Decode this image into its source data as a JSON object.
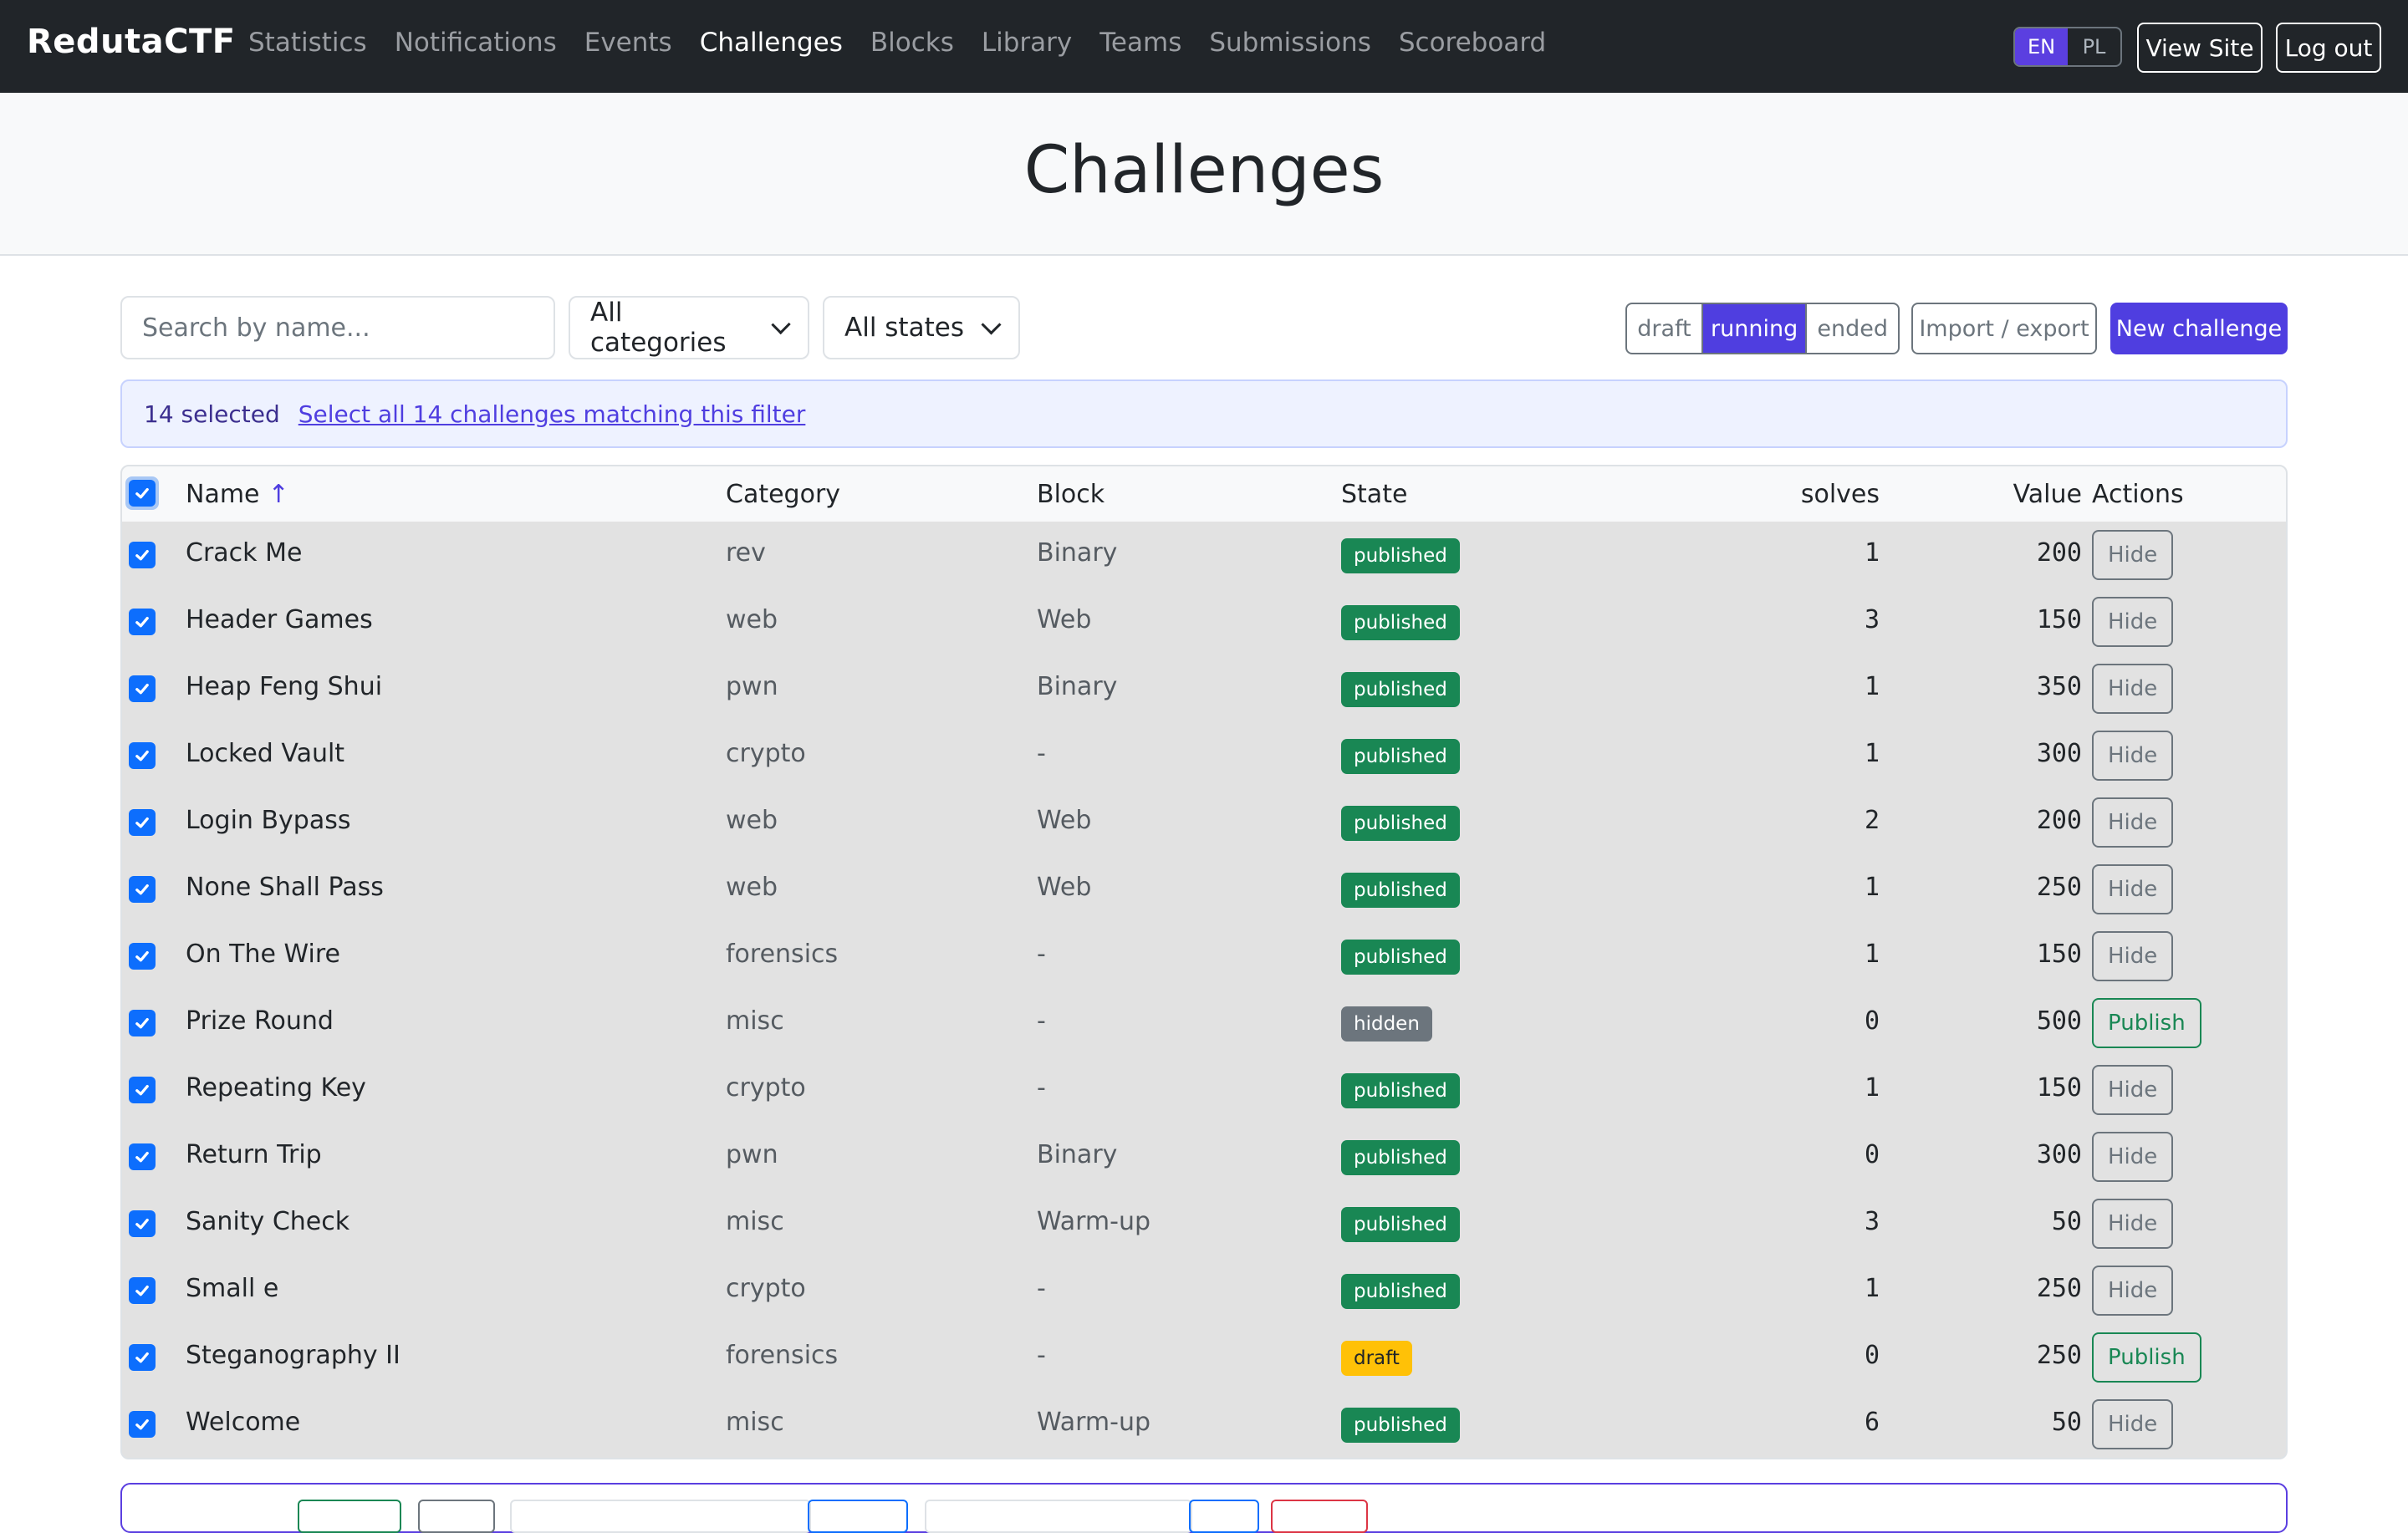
{
  "brand": "RedutaCTF",
  "nav": {
    "links": [
      "Statistics",
      "Notifications",
      "Events",
      "Challenges",
      "Blocks",
      "Library",
      "Teams",
      "Submissions",
      "Scoreboard"
    ],
    "active": "Challenges",
    "lang": [
      "EN",
      "PL"
    ],
    "lang_active": "EN",
    "view_site": "View Site",
    "logout": "Log out"
  },
  "page": {
    "title": "Challenges"
  },
  "toolbar": {
    "search_placeholder": "Search by name...",
    "category_select": "All categories",
    "state_select": "All states",
    "state_toggle": [
      "draft",
      "running",
      "ended"
    ],
    "state_toggle_active": "running",
    "import_export": "Import / export",
    "new_challenge": "New challenge"
  },
  "selection": {
    "count_text": "14 selected",
    "select_all_text": "Select all 14 challenges matching this filter"
  },
  "table": {
    "headers": {
      "name": "Name",
      "sort_indicator": "↑",
      "category": "Category",
      "block": "Block",
      "state": "State",
      "solves": "solves",
      "value": "Value",
      "actions": "Actions"
    },
    "rows": [
      {
        "name": "Crack Me",
        "category": "rev",
        "block": "Binary",
        "state": "published",
        "solves": "1",
        "value": "200",
        "action": "Hide"
      },
      {
        "name": "Header Games",
        "category": "web",
        "block": "Web",
        "state": "published",
        "solves": "3",
        "value": "150",
        "action": "Hide"
      },
      {
        "name": "Heap Feng Shui",
        "category": "pwn",
        "block": "Binary",
        "state": "published",
        "solves": "1",
        "value": "350",
        "action": "Hide"
      },
      {
        "name": "Locked Vault",
        "category": "crypto",
        "block": "-",
        "state": "published",
        "solves": "1",
        "value": "300",
        "action": "Hide"
      },
      {
        "name": "Login Bypass",
        "category": "web",
        "block": "Web",
        "state": "published",
        "solves": "2",
        "value": "200",
        "action": "Hide"
      },
      {
        "name": "None Shall Pass",
        "category": "web",
        "block": "Web",
        "state": "published",
        "solves": "1",
        "value": "250",
        "action": "Hide"
      },
      {
        "name": "On The Wire",
        "category": "forensics",
        "block": "-",
        "state": "published",
        "solves": "1",
        "value": "150",
        "action": "Hide"
      },
      {
        "name": "Prize Round",
        "category": "misc",
        "block": "-",
        "state": "hidden",
        "solves": "0",
        "value": "500",
        "action": "Publish"
      },
      {
        "name": "Repeating Key",
        "category": "crypto",
        "block": "-",
        "state": "published",
        "solves": "1",
        "value": "150",
        "action": "Hide"
      },
      {
        "name": "Return Trip",
        "category": "pwn",
        "block": "Binary",
        "state": "published",
        "solves": "0",
        "value": "300",
        "action": "Hide"
      },
      {
        "name": "Sanity Check",
        "category": "misc",
        "block": "Warm-up",
        "state": "published",
        "solves": "3",
        "value": "50",
        "action": "Hide"
      },
      {
        "name": "Small e",
        "category": "crypto",
        "block": "-",
        "state": "published",
        "solves": "1",
        "value": "250",
        "action": "Hide"
      },
      {
        "name": "Steganography II",
        "category": "forensics",
        "block": "-",
        "state": "draft",
        "solves": "0",
        "value": "250",
        "action": "Publish"
      },
      {
        "name": "Welcome",
        "category": "misc",
        "block": "Warm-up",
        "state": "published",
        "solves": "6",
        "value": "50",
        "action": "Hide"
      }
    ]
  },
  "colors": {
    "navbar": "#212529",
    "accent": "#4f3ee0",
    "published": "#198754",
    "hidden": "#6c757d",
    "draft": "#ffc107",
    "checkbox": "#0d6efd"
  }
}
